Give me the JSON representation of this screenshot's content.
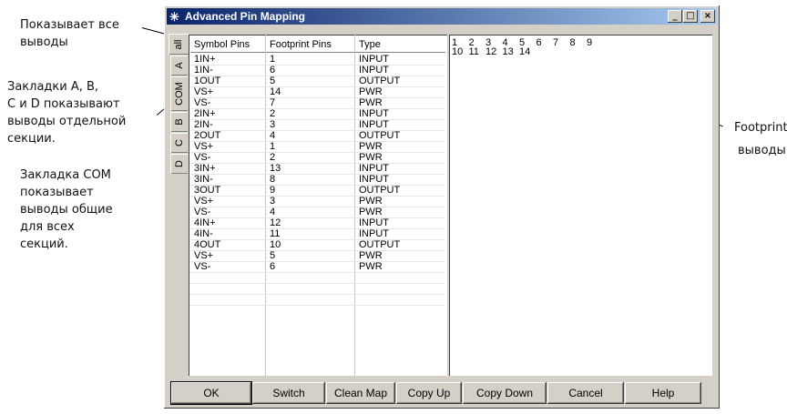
{
  "annotations": {
    "all_pins": "Показывает все\nвыводы",
    "section_tabs": "Закладки A, B,\nC и D показывают\nвыводы отдельной\nсекции.",
    "com_tab": "Закладка COM\nпоказывает\nвыводы общие\nдля всех\nсекций.",
    "footprint_word": "Footprint",
    "footprint_pins": "выводы"
  },
  "window": {
    "title": "Advanced Pin Mapping",
    "minimize": "_",
    "maximize": "□",
    "close": "×"
  },
  "tabs": [
    "all",
    "A",
    "COM",
    "B",
    "C",
    "D"
  ],
  "grid": {
    "headers": [
      "Symbol Pins",
      "Footprint Pins",
      "Type"
    ],
    "rows": [
      [
        "1IN+",
        "1",
        "INPUT"
      ],
      [
        "1IN-",
        "6",
        "INPUT"
      ],
      [
        "1OUT",
        "5",
        "OUTPUT"
      ],
      [
        "VS+",
        "14",
        "PWR"
      ],
      [
        "VS-",
        "7",
        "PWR"
      ],
      [
        "2IN+",
        "2",
        "INPUT"
      ],
      [
        "2IN-",
        "3",
        "INPUT"
      ],
      [
        "2OUT",
        "4",
        "OUTPUT"
      ],
      [
        "VS+",
        "1",
        "PWR"
      ],
      [
        "VS-",
        "2",
        "PWR"
      ],
      [
        "3IN+",
        "13",
        "INPUT"
      ],
      [
        "3IN-",
        "8",
        "INPUT"
      ],
      [
        "3OUT",
        "9",
        "OUTPUT"
      ],
      [
        "VS+",
        "3",
        "PWR"
      ],
      [
        "VS-",
        "4",
        "PWR"
      ],
      [
        "4IN+",
        "12",
        "INPUT"
      ],
      [
        "4IN-",
        "11",
        "INPUT"
      ],
      [
        "4OUT",
        "10",
        "OUTPUT"
      ],
      [
        "VS+",
        "5",
        "PWR"
      ],
      [
        "VS-",
        "6",
        "PWR"
      ],
      [
        "",
        "",
        ""
      ],
      [
        "",
        "",
        ""
      ],
      [
        "",
        "",
        ""
      ]
    ]
  },
  "footprint_pins": [
    "1",
    "2",
    "3",
    "4",
    "5",
    "6",
    "7",
    "8",
    "9",
    "10",
    "11",
    "12",
    "13",
    "14"
  ],
  "buttons": {
    "ok": "OK",
    "switch": "Switch",
    "clean_map": "Clean Map",
    "copy_up": "Copy Up",
    "copy_down": "Copy Down",
    "cancel": "Cancel",
    "help": "Help"
  }
}
